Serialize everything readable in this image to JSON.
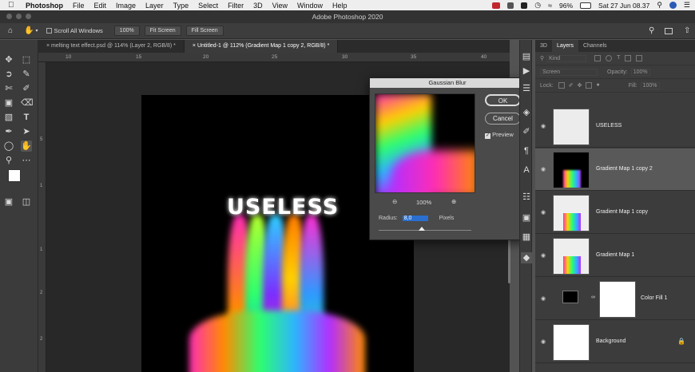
{
  "menubar": {
    "apple": "",
    "app": "Photoshop",
    "items": [
      "File",
      "Edit",
      "Image",
      "Layer",
      "Type",
      "Select",
      "Filter",
      "3D",
      "View",
      "Window",
      "Help"
    ],
    "battery": "96%",
    "datetime": "Sat 27 Jun  08.37"
  },
  "window": {
    "title": "Adobe Photoshop 2020"
  },
  "options": {
    "scroll_all": "Scroll All Windows",
    "zoom": "100%",
    "fit": "Fit Screen",
    "fill": "Fill Screen"
  },
  "tabs": [
    {
      "label": "melting text effect.psd @ 114% (Layer 2, RGB/8) *"
    },
    {
      "label": "Untitled-1 @ 112% (Gradient Map 1 copy 2, RGB/8) *"
    }
  ],
  "ruler": {
    "top": [
      "10",
      "15",
      "20",
      "25",
      "30",
      "35",
      "40",
      "45"
    ],
    "left": [
      "5",
      "1",
      "1",
      "2",
      "2",
      "3"
    ]
  },
  "artwork": {
    "text": "USELESS"
  },
  "dialog": {
    "title": "Gaussian Blur",
    "ok": "OK",
    "cancel": "Cancel",
    "preview_label": "Preview",
    "zoom": "100%",
    "radius_label": "Radius:",
    "radius_value": "8,0",
    "unit": "Pixels"
  },
  "panel": {
    "tabs": [
      "3D",
      "Layers",
      "Channels"
    ],
    "kind_placeholder": "Kind",
    "blend": "Screen",
    "opacity_label": "Opacity:",
    "opacity": "100%",
    "lock_label": "Lock:",
    "fill_label": "Fill:",
    "fill": "100%",
    "layers": [
      {
        "name": "USELESS"
      },
      {
        "name": "Gradient Map 1 copy 2"
      },
      {
        "name": "Gradient Map 1 copy"
      },
      {
        "name": "Gradient Map 1"
      },
      {
        "name": "Color Fill 1"
      },
      {
        "name": "Background"
      }
    ]
  },
  "colors": {
    "selected": "#595959",
    "accent": "#2a6fcf"
  }
}
